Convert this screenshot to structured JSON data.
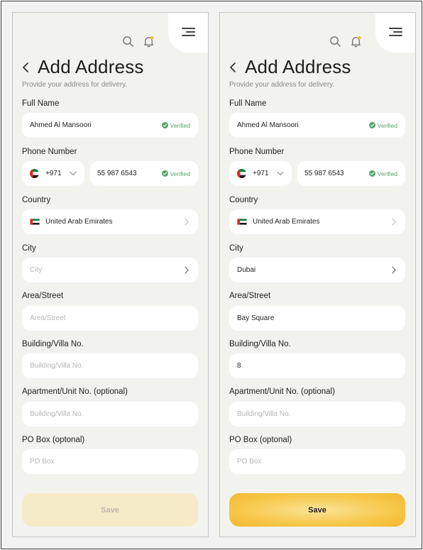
{
  "screens": [
    {
      "title": "Add Address",
      "subtitle": "Provide your address for delivery.",
      "full_name": {
        "label": "Full Name",
        "value": "Ahmed Al Mansoori",
        "badge": "Verified"
      },
      "phone": {
        "label": "Phone Number",
        "code": "+971",
        "number": "55 987 6543",
        "badge": "Verified"
      },
      "country": {
        "label": "Country",
        "value": "United Arab Emirates"
      },
      "city": {
        "label": "City",
        "value": "",
        "placeholder": "City"
      },
      "area": {
        "label": "Area/Street",
        "value": "",
        "placeholder": "Area/Street"
      },
      "building": {
        "label": "Building/Villa No.",
        "value": "",
        "placeholder": "Building/Villa No."
      },
      "apartment": {
        "label": "Apartment/Unit No. (optional)",
        "value": "",
        "placeholder": "Building/Villa No."
      },
      "po_box": {
        "label": "PO Box (optonal)",
        "value": "",
        "placeholder": "PO Box"
      },
      "save_label": "Save",
      "save_state": "disabled"
    },
    {
      "title": "Add Address",
      "subtitle": "Provide your address for delivery.",
      "full_name": {
        "label": "Full Name",
        "value": "Ahmed Al Mansoori",
        "badge": "Verified"
      },
      "phone": {
        "label": "Phone Number",
        "code": "+971",
        "number": "55 987 6543",
        "badge": "Verified"
      },
      "country": {
        "label": "Country",
        "value": "United Arab Emirates"
      },
      "city": {
        "label": "City",
        "value": "Dubai",
        "placeholder": "City"
      },
      "area": {
        "label": "Area/Street",
        "value": "Bay Square",
        "placeholder": "Area/Street"
      },
      "building": {
        "label": "Building/Villa No.",
        "value": "8",
        "placeholder": "Building/Villa No."
      },
      "apartment": {
        "label": "Apartment/Unit No. (optional)",
        "value": "",
        "placeholder": "Building/Villa No."
      },
      "po_box": {
        "label": "PO Box (optonal)",
        "value": "",
        "placeholder": "PO Box"
      },
      "save_label": "Save",
      "save_state": "active"
    }
  ],
  "colors": {
    "background": "#f2f2ef",
    "field": "#ffffff",
    "verified": "#57a36a",
    "notification_dot": "#f4c02f",
    "save_active": "#f7c84a",
    "save_disabled": "#f6ebc8"
  },
  "icons": [
    "search-icon",
    "bell-icon",
    "menu-icon",
    "back-arrow-icon",
    "check-circle-icon",
    "chevron-right-icon",
    "chevron-down-icon",
    "uae-flag-icon"
  ]
}
